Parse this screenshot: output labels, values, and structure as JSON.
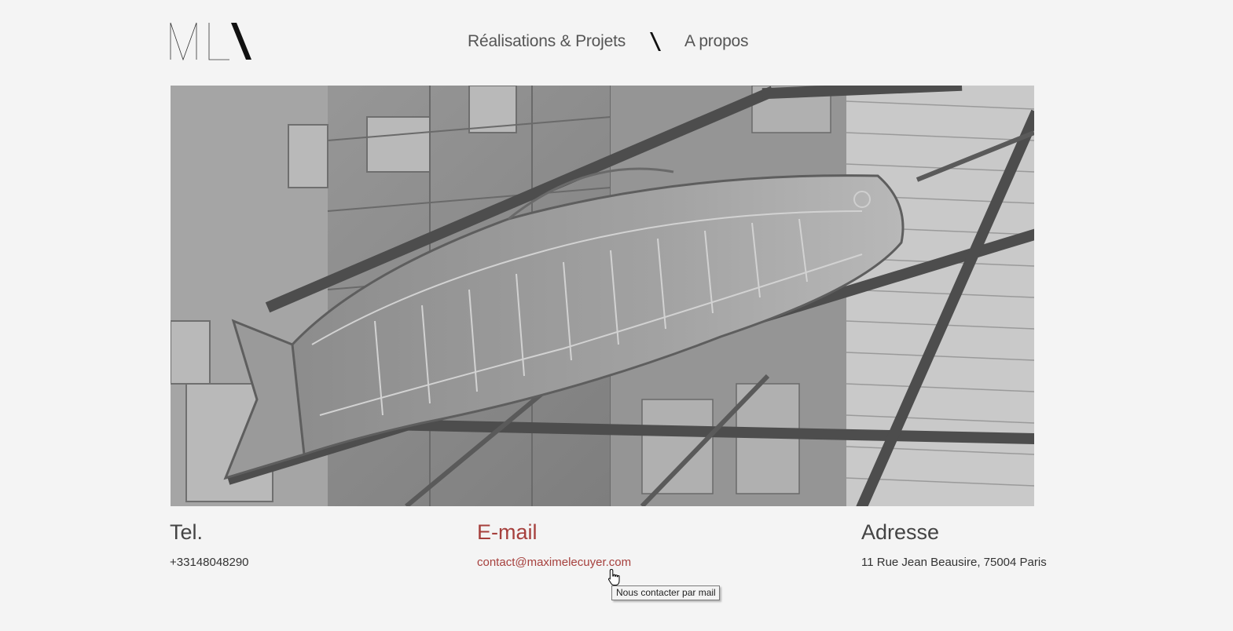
{
  "header": {
    "logo_text": "ML\\",
    "nav": {
      "items": [
        {
          "label": "Réalisations & Projets"
        },
        {
          "label": "A propos"
        }
      ]
    }
  },
  "hero": {
    "image_name": "neon-fish-sign-photo"
  },
  "contact": {
    "tel": {
      "heading": "Tel.",
      "value": "+33148048290"
    },
    "email": {
      "heading": "E-mail",
      "value": "contact@maximelecuyer.com"
    },
    "address": {
      "heading": "Adresse",
      "value": "11 Rue Jean Beausire, 75004 Paris"
    }
  },
  "tooltip": {
    "text": "Nous contacter par mail"
  },
  "colors": {
    "background": "#f4f4f4",
    "accent": "#a6403d",
    "text": "#333333"
  }
}
